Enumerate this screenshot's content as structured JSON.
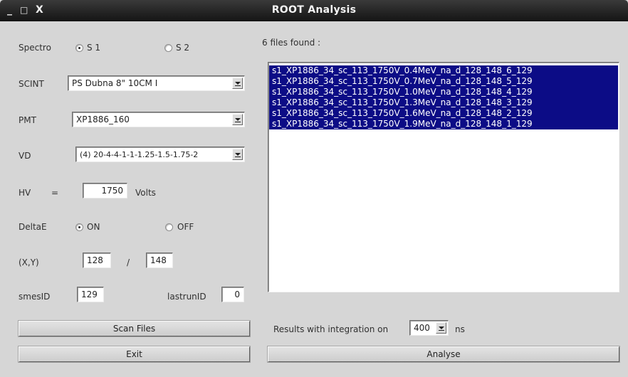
{
  "window": {
    "title": "ROOT Analysis",
    "controls": [
      "_",
      "□",
      "X"
    ]
  },
  "left": {
    "spectro": {
      "label": "Spectro",
      "options": [
        "S 1",
        "S 2"
      ],
      "selected": "S 1"
    },
    "scint": {
      "label": "SCINT",
      "value": "PS Dubna 8\" 10CM   I"
    },
    "pmt": {
      "label": "PMT",
      "value": "XP1886_160"
    },
    "vd": {
      "label": "VD",
      "value": "(4) 20-4-4-1-1-1.25-1.5-1.75-2"
    },
    "hv": {
      "label": "HV",
      "eq": "=",
      "value": "1750",
      "unit": "Volts"
    },
    "deltae": {
      "label": "DeltaE",
      "options": [
        "ON",
        "OFF"
      ],
      "selected": "ON"
    },
    "xy": {
      "label": "(X,Y)",
      "x": "128",
      "sep": "/",
      "y": "148"
    },
    "smesid": {
      "label": "smesID",
      "value": "129"
    },
    "lastrunid": {
      "label": "lastrunID",
      "value": "0"
    },
    "scan_button": "Scan Files",
    "exit_button": "Exit"
  },
  "right": {
    "files_found": "6 files found :",
    "files": [
      "s1_XP1886_34_sc_113_1750V_0.4MeV_na_d_128_148_6_129",
      "s1_XP1886_34_sc_113_1750V_0.7MeV_na_d_128_148_5_129",
      "s1_XP1886_34_sc_113_1750V_1.0MeV_na_d_128_148_4_129",
      "s1_XP1886_34_sc_113_1750V_1.3MeV_na_d_128_148_3_129",
      "s1_XP1886_34_sc_113_1750V_1.6MeV_na_d_128_148_2_129",
      "s1_XP1886_34_sc_113_1750V_1.9MeV_na_d_128_148_1_129"
    ],
    "integration_label": "Results with integration on",
    "integration_value": "400",
    "integration_unit": "ns",
    "analyse_button": "Analyse"
  },
  "colors": {
    "selection": "#0c0c86",
    "titlebar": "#1e1e1e",
    "window_bg": "#d6d6d6"
  }
}
